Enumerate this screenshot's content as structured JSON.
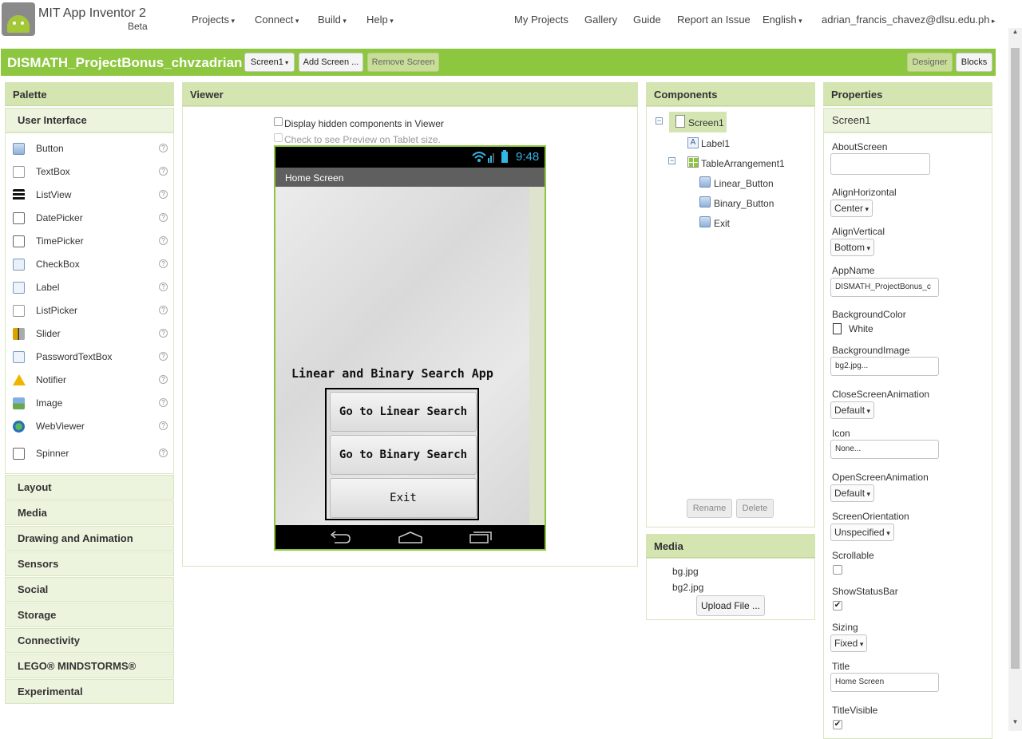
{
  "header": {
    "app_name": "MIT App Inventor 2",
    "beta": "Beta",
    "menus": [
      "Projects",
      "Connect",
      "Build",
      "Help"
    ],
    "links": [
      "My Projects",
      "Gallery",
      "Guide",
      "Report an Issue"
    ],
    "language": "English",
    "user": "adrian_francis_chavez@dlsu.edu.ph"
  },
  "project": {
    "name": "DISMATH_ProjectBonus_chvzadrian",
    "screen_select": "Screen1",
    "add_screen": "Add Screen ...",
    "remove_screen": "Remove Screen",
    "designer": "Designer",
    "blocks": "Blocks"
  },
  "palette": {
    "title": "Palette",
    "section": "User Interface",
    "items": [
      {
        "label": "Button",
        "icon": "button-icon"
      },
      {
        "label": "TextBox",
        "icon": "textbox-icon"
      },
      {
        "label": "ListView",
        "icon": "listview-icon"
      },
      {
        "label": "DatePicker",
        "icon": "datepicker-icon"
      },
      {
        "label": "TimePicker",
        "icon": "timepicker-icon"
      },
      {
        "label": "CheckBox",
        "icon": "checkbox-icon"
      },
      {
        "label": "Label",
        "icon": "label-icon"
      },
      {
        "label": "ListPicker",
        "icon": "listpicker-icon"
      },
      {
        "label": "Slider",
        "icon": "slider-icon"
      },
      {
        "label": "PasswordTextBox",
        "icon": "passwordtextbox-icon"
      },
      {
        "label": "Notifier",
        "icon": "notifier-icon"
      },
      {
        "label": "Image",
        "icon": "image-icon"
      },
      {
        "label": "WebViewer",
        "icon": "webviewer-icon"
      },
      {
        "label": "Spinner",
        "icon": "spinner-icon"
      }
    ],
    "help_glyph": "?",
    "drawers": [
      "Layout",
      "Media",
      "Drawing and Animation",
      "Sensors",
      "Social",
      "Storage",
      "Connectivity",
      "LEGO® MINDSTORMS®",
      "Experimental"
    ]
  },
  "viewer": {
    "title": "Viewer",
    "hidden_components": "Display hidden components in Viewer",
    "tablet_preview": "Check to see Preview on Tablet size.",
    "phone": {
      "time": "9:48",
      "screen_title": "Home Screen",
      "heading": "Linear and Binary Search App",
      "buttons": [
        "Go to Linear Search",
        "Go to Binary Search",
        "Exit"
      ]
    }
  },
  "components": {
    "title": "Components",
    "tree": [
      "Screen1",
      "Label1",
      "TableArrangement1",
      "Linear_Button",
      "Binary_Button",
      "Exit"
    ],
    "rename": "Rename",
    "delete": "Delete"
  },
  "media": {
    "title": "Media",
    "files": [
      "bg.jpg",
      "bg2.jpg"
    ],
    "upload": "Upload File ..."
  },
  "properties": {
    "title": "Properties",
    "component": "Screen1",
    "about_screen_label": "AboutScreen",
    "about_screen_value": "",
    "align_horizontal_label": "AlignHorizontal",
    "align_horizontal_value": "Center",
    "align_vertical_label": "AlignVertical",
    "align_vertical_value": "Bottom",
    "app_name_label": "AppName",
    "app_name_value": "DISMATH_ProjectBonus_c",
    "background_color_label": "BackgroundColor",
    "background_color_value": "White",
    "background_image_label": "BackgroundImage",
    "background_image_value": "bg2.jpg...",
    "close_anim_label": "CloseScreenAnimation",
    "close_anim_value": "Default",
    "icon_label": "Icon",
    "icon_value": "None...",
    "open_anim_label": "OpenScreenAnimation",
    "open_anim_value": "Default",
    "orientation_label": "ScreenOrientation",
    "orientation_value": "Unspecified",
    "scrollable_label": "Scrollable",
    "scrollable_checked": false,
    "show_status_label": "ShowStatusBar",
    "show_status_checked": true,
    "sizing_label": "Sizing",
    "sizing_value": "Fixed",
    "title_label": "Title",
    "title_value": "Home Screen",
    "title_visible_label": "TitleVisible",
    "title_visible_checked": true,
    "check_glyph": "✔"
  },
  "colors": {
    "accent": "#8dc63f",
    "panel_header": "#d4e5b2"
  }
}
